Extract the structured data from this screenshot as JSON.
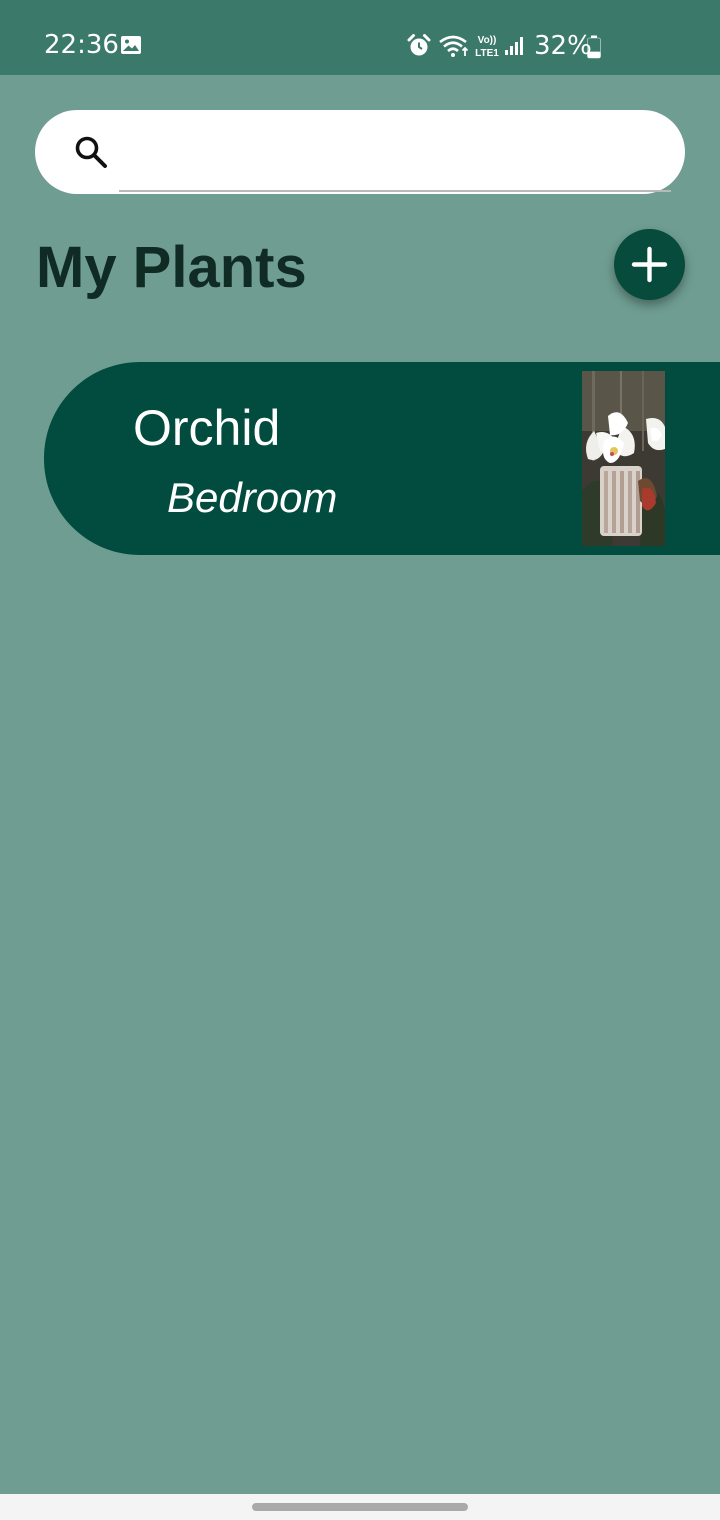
{
  "status_bar": {
    "time": "22:36",
    "battery_percent": "32%",
    "icons": [
      "gallery-icon",
      "alarm-icon",
      "wifi-icon",
      "volte-lte-icon",
      "signal-icon",
      "battery-icon"
    ],
    "volte_label_top": "Vo))",
    "volte_label_bottom": "LTE1",
    "battery_level": 0.32
  },
  "search": {
    "placeholder": "",
    "value": "",
    "icon": "search-icon"
  },
  "header": {
    "title": "My Plants",
    "add_icon": "plus-icon"
  },
  "plants": [
    {
      "name": "Orchid",
      "location": "Bedroom",
      "photo": "orchid-photo"
    }
  ],
  "colors": {
    "background": "#6f9d91",
    "status_bar": "#3b7a6b",
    "card": "#014b3f",
    "title": "#0f2b23",
    "fab": "#064b3c"
  }
}
